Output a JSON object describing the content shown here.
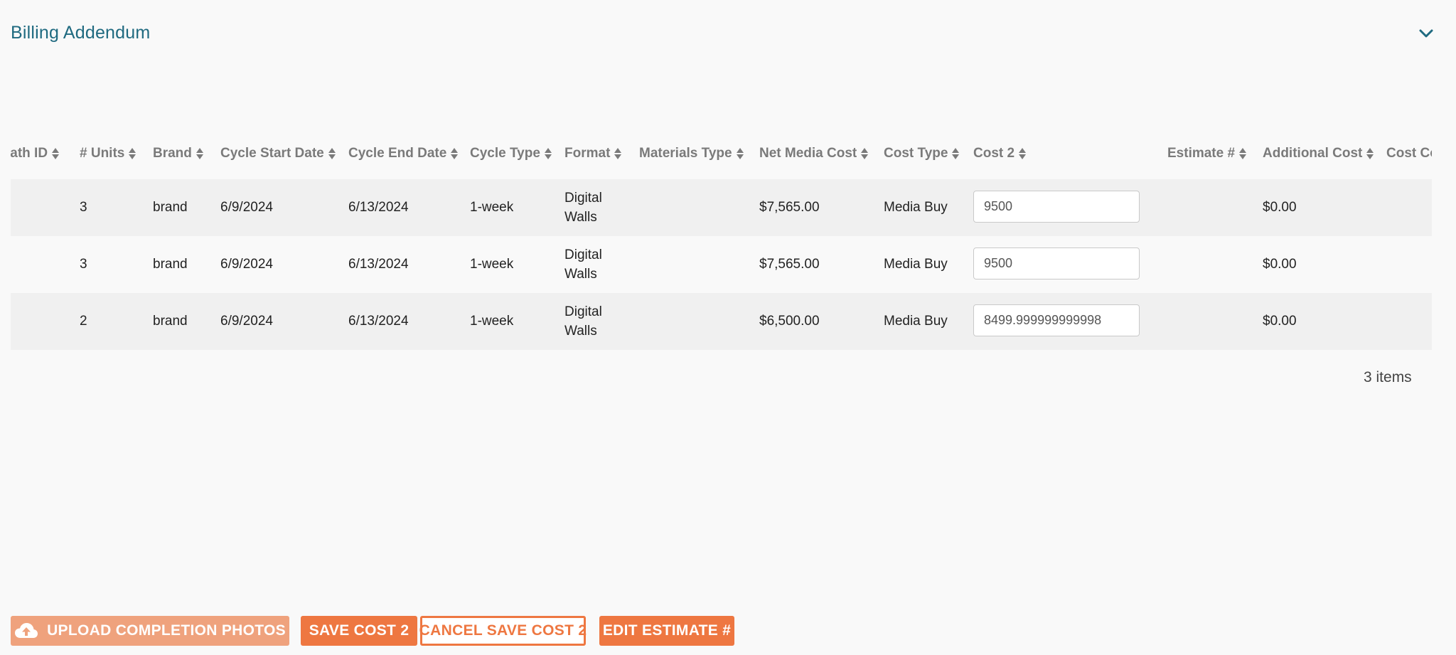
{
  "header": {
    "title": "Billing Addendum",
    "toggle_icon": "chevron-down-icon"
  },
  "table": {
    "columns": [
      "ıath ID",
      "# Units",
      "Brand",
      "Cycle Start Date",
      "Cycle End Date",
      "Cycle Type",
      "Format",
      "Materials Type",
      "Net Media Cost",
      "Cost Type",
      "Cost 2",
      "Estimate #",
      "Additional Cost",
      "Cost Co"
    ],
    "rows": [
      {
        "units": "3",
        "brand": "brand",
        "cycle_start": "6/9/2024",
        "cycle_end": "6/13/2024",
        "cycle_type": "1-week",
        "format": "Digital Walls",
        "materials_type": "",
        "net_media_cost": "$7,565.00",
        "cost_type": "Media Buy",
        "cost2": "9500",
        "estimate": "",
        "additional_cost": "$0.00"
      },
      {
        "units": "3",
        "brand": "brand",
        "cycle_start": "6/9/2024",
        "cycle_end": "6/13/2024",
        "cycle_type": "1-week",
        "format": "Digital Walls",
        "materials_type": "",
        "net_media_cost": "$7,565.00",
        "cost_type": "Media Buy",
        "cost2": "9500",
        "estimate": "",
        "additional_cost": "$0.00"
      },
      {
        "units": "2",
        "brand": "brand",
        "cycle_start": "6/9/2024",
        "cycle_end": "6/13/2024",
        "cycle_type": "1-week",
        "format": "Digital Walls",
        "materials_type": "",
        "net_media_cost": "$6,500.00",
        "cost_type": "Media Buy",
        "cost2": "8499.999999999998",
        "estimate": "",
        "additional_cost": "$0.00"
      }
    ],
    "items_count": "3 items"
  },
  "actions": {
    "upload_label": "UPLOAD COMPLETION PHOTOS",
    "upload_icon": "cloud-upload-icon",
    "save_label": "SAVE COST 2",
    "cancel_label": "CANCEL SAVE COST 2",
    "edit_label": "EDIT ESTIMATE #"
  },
  "colors": {
    "title": "#1f6a80",
    "accent": "#ee7741",
    "accent_disabled": "#efa27d",
    "header_text": "#7a7a7a",
    "row_stripe": "#f0f0f0"
  }
}
